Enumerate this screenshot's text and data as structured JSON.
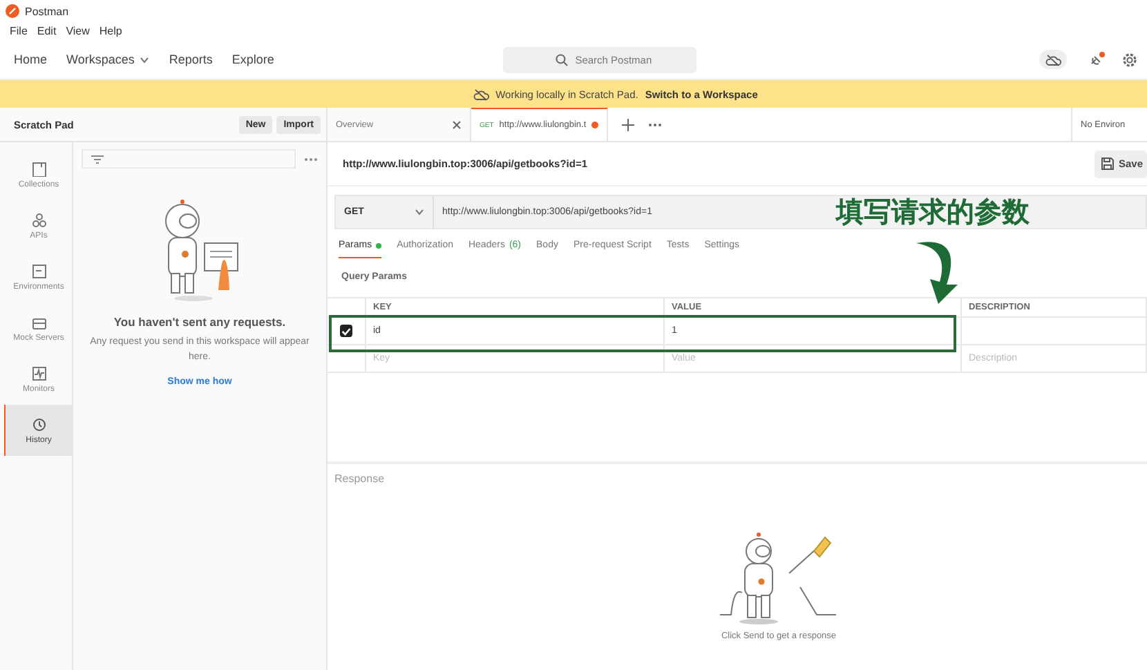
{
  "app": {
    "title": "Postman"
  },
  "menu": [
    "File",
    "Edit",
    "View",
    "Help"
  ],
  "nav": [
    {
      "label": "Home",
      "dropdown": false
    },
    {
      "label": "Workspaces",
      "dropdown": true
    },
    {
      "label": "Reports",
      "dropdown": false
    },
    {
      "label": "Explore",
      "dropdown": false
    }
  ],
  "search": {
    "placeholder": "Search Postman"
  },
  "banner": {
    "text": "Working locally in Scratch Pad.",
    "link": "Switch to a Workspace"
  },
  "sidebar": {
    "title": "Scratch Pad",
    "buttons": [
      "New",
      "Import"
    ],
    "items": [
      {
        "kind": "collections",
        "label": "Collections",
        "selected": false
      },
      {
        "kind": "apis",
        "label": "APIs",
        "selected": false
      },
      {
        "kind": "environments",
        "label": "Environments",
        "selected": false
      },
      {
        "kind": "mock",
        "label": "Mock Servers",
        "selected": false
      },
      {
        "kind": "monitors",
        "label": "Monitors",
        "selected": false
      },
      {
        "kind": "history",
        "label": "History",
        "selected": true
      }
    ],
    "empty": {
      "title": "You haven't sent any requests.",
      "text": "Any request you send in this workspace will appear here.",
      "link": "Show me how"
    }
  },
  "tabs": [
    {
      "kind": "page",
      "label": "Overview",
      "selected": false,
      "unsaved": false
    },
    {
      "kind": "request",
      "method": "GET",
      "label": "http://www.liulongbin.t",
      "selected": true,
      "unsaved": true
    }
  ],
  "environment": "No Environ",
  "request": {
    "title": "http://www.liulongbin.top:3006/api/getbooks?id=1",
    "save": "Save",
    "method": "GET",
    "url": "http://www.liulongbin.top:3006/api/getbooks?id=1"
  },
  "request_tabs": [
    {
      "label": "Params",
      "selected": true,
      "indicator": true
    },
    {
      "label": "Authorization",
      "selected": false,
      "indicator": false
    },
    {
      "label": "Headers",
      "count": "(6)",
      "selected": false,
      "indicator": false
    },
    {
      "label": "Body",
      "selected": false,
      "indicator": false
    },
    {
      "label": "Pre-request Script",
      "selected": false,
      "indicator": false
    },
    {
      "label": "Tests",
      "selected": false,
      "indicator": false
    },
    {
      "label": "Settings",
      "selected": false,
      "indicator": false
    }
  ],
  "query_params": {
    "title": "Query Params",
    "columns": [
      "KEY",
      "VALUE",
      "DESCRIPTION"
    ],
    "rows": [
      {
        "checked": true,
        "key": "id",
        "value": "1"
      }
    ],
    "new_row": [
      {
        "placeholder": "Key"
      },
      {
        "placeholder": "Value"
      },
      {
        "placeholder": "Description"
      }
    ]
  },
  "response": {
    "title": "Response",
    "hint": "Click Send to get a response"
  },
  "annotation": {
    "text": "填写请求的参数"
  }
}
